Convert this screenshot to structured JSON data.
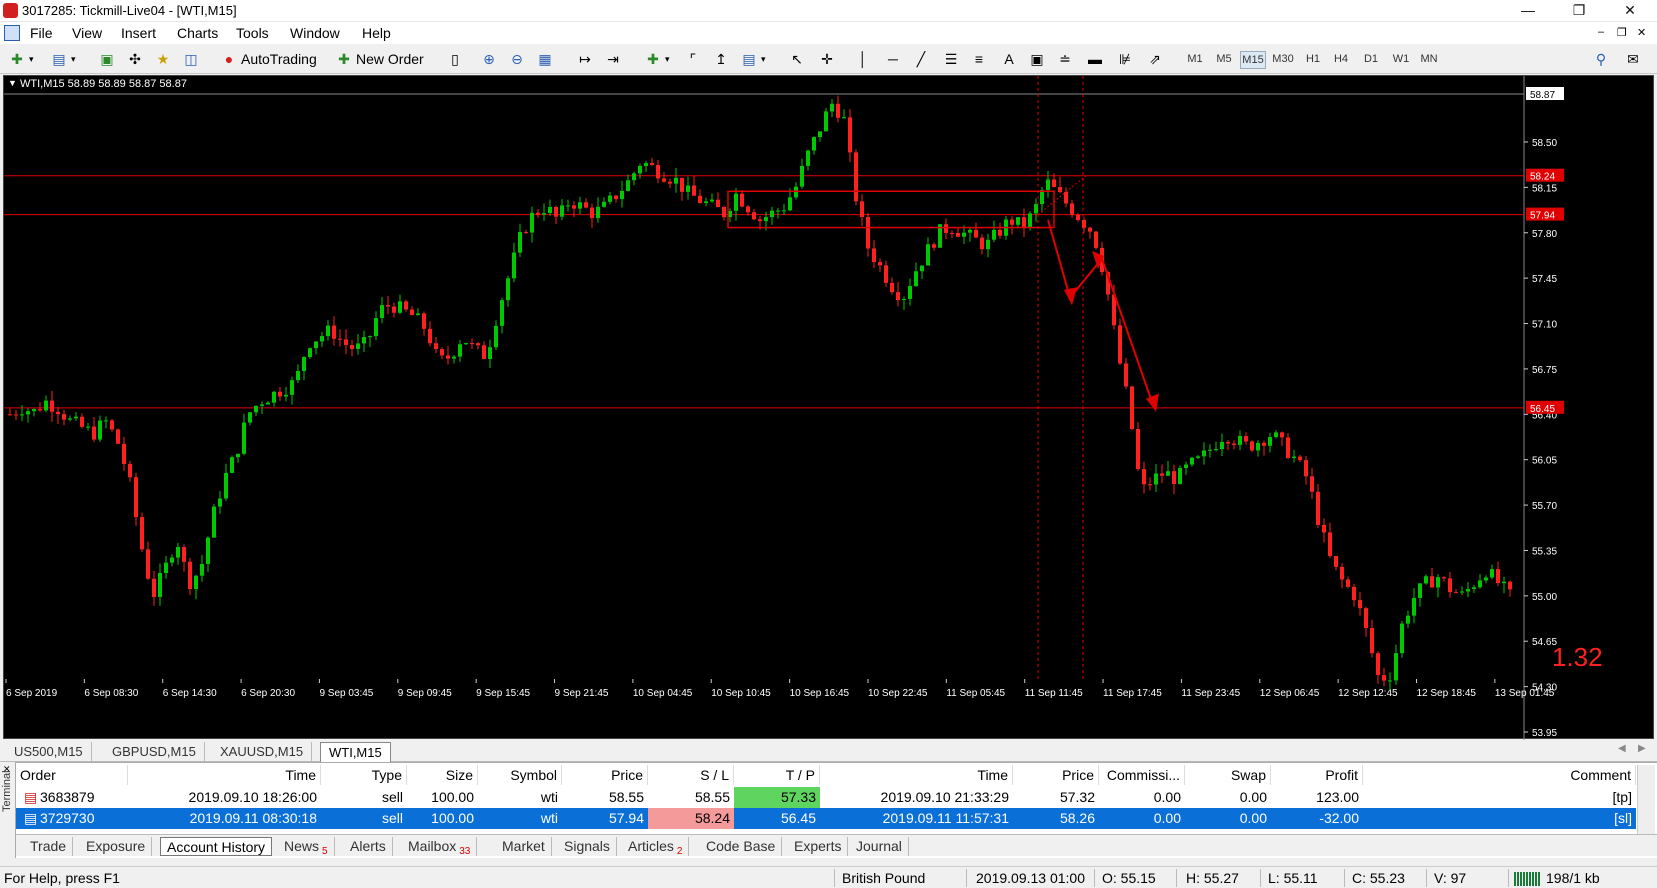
{
  "window": {
    "title": "3017285: Tickmill-Live04 - [WTI,M15]"
  },
  "menu": [
    "File",
    "View",
    "Insert",
    "Charts",
    "Tools",
    "Window",
    "Help"
  ],
  "toolbar": {
    "autotrading": "AutoTrading",
    "new_order": "New Order",
    "timeframes": [
      "M1",
      "M5",
      "M15",
      "M30",
      "H1",
      "H4",
      "D1",
      "W1",
      "MN"
    ],
    "active_timeframe": "M15"
  },
  "chart": {
    "header": "WTI,M15  58.89 58.89 58.87 58.87",
    "current_price": "58.87",
    "price_ticks": [
      "58.50",
      "58.15",
      "57.80",
      "57.45",
      "57.10",
      "56.75",
      "56.40",
      "56.05",
      "55.70",
      "55.35",
      "55.00",
      "54.65",
      "54.30",
      "53.95"
    ],
    "hline_labels": [
      "58.24",
      "57.94",
      "56.45"
    ],
    "time_ticks": [
      "6 Sep 2019",
      "6 Sep 08:30",
      "6 Sep 14:30",
      "6 Sep 20:30",
      "9 Sep 03:45",
      "9 Sep 09:45",
      "9 Sep 15:45",
      "9 Sep 21:45",
      "10 Sep 04:45",
      "10 Sep 10:45",
      "10 Sep 16:45",
      "10 Sep 22:45",
      "11 Sep 05:45",
      "11 Sep 11:45",
      "11 Sep 17:45",
      "11 Sep 23:45",
      "12 Sep 06:45",
      "12 Sep 12:45",
      "12 Sep 18:45",
      "13 Sep 01:45"
    ],
    "spread": "1.32",
    "colors": {
      "bull": "#00c800",
      "bear": "#ff2020",
      "levels": "#e00000",
      "background": "#000000"
    }
  },
  "chart_data": {
    "type": "candlestick",
    "ylim": [
      53.95,
      58.87
    ],
    "close_path": [
      56.4,
      56.45,
      56.42,
      56.5,
      56.45,
      56.35,
      56.3,
      56.25,
      56.35,
      56.2,
      55.9,
      55.4,
      55.0,
      55.2,
      55.45,
      55.1,
      55.2,
      55.6,
      55.9,
      56.1,
      56.4,
      56.5,
      56.55,
      56.6,
      56.65,
      56.95,
      57.0,
      57.05,
      56.95,
      56.9,
      56.95,
      57.2,
      57.25,
      57.2,
      57.15,
      57.05,
      56.8,
      56.85,
      57.0,
      56.9,
      56.85,
      57.2,
      57.5,
      57.8,
      57.95,
      58.0,
      57.9,
      58.05,
      58.0,
      57.95,
      58.0,
      58.1,
      58.2,
      58.35,
      58.3,
      58.25,
      58.2,
      58.1,
      58.05,
      58.0,
      57.95,
      58.1,
      58.0,
      57.9,
      57.95,
      58.0,
      58.15,
      58.4,
      58.6,
      58.8,
      58.7,
      58.1,
      57.7,
      57.55,
      57.4,
      57.3,
      57.5,
      57.65,
      57.8,
      57.85,
      57.8,
      57.75,
      57.7,
      57.8,
      57.9,
      57.85,
      57.95,
      58.2,
      58.1,
      58.0,
      57.9,
      57.8,
      57.45,
      56.9,
      56.45,
      55.8,
      55.9,
      55.95,
      55.9,
      56.0,
      56.05,
      56.15,
      56.25,
      56.2,
      56.15,
      56.2,
      56.25,
      56.15,
      56.05,
      55.9,
      55.55,
      55.25,
      55.1,
      55.0,
      54.7,
      54.35,
      54.4,
      54.8,
      55.0,
      55.1,
      55.15,
      55.05,
      55.0,
      55.1,
      55.2,
      55.1,
      55.0
    ],
    "horizontal_levels": [
      58.24,
      57.94,
      56.45
    ]
  },
  "chart_tabs": [
    {
      "label": "US500,M15",
      "active": false
    },
    {
      "label": "GBPUSD,M15",
      "active": false
    },
    {
      "label": "XAUUSD,M15",
      "active": false
    },
    {
      "label": "WTI,M15",
      "active": true
    }
  ],
  "terminal": {
    "side_label": "Terminal",
    "columns": [
      "Order",
      "Time",
      "Type",
      "Size",
      "Symbol",
      "Price",
      "S / L",
      "T / P",
      "Time",
      "Price",
      "Commissi...",
      "Swap",
      "Profit",
      "Comment"
    ],
    "rows": [
      {
        "order": "3683879",
        "open_time": "2019.09.10 18:26:00",
        "type": "sell",
        "size": "100.00",
        "symbol": "wti",
        "price": "58.55",
        "sl": "58.55",
        "tp": "57.33",
        "close_time": "2019.09.10 21:33:29",
        "close_price": "57.32",
        "commission": "0.00",
        "swap": "0.00",
        "profit": "123.00",
        "comment": "[tp]",
        "selected": false
      },
      {
        "order": "3729730",
        "open_time": "2019.09.11 08:30:18",
        "type": "sell",
        "size": "100.00",
        "symbol": "wti",
        "price": "57.94",
        "sl": "58.24",
        "tp": "56.45",
        "close_time": "2019.09.11 11:57:31",
        "close_price": "58.26",
        "commission": "0.00",
        "swap": "0.00",
        "profit": "-32.00",
        "comment": "[sl]",
        "selected": true
      }
    ],
    "tabs": [
      {
        "label": "Trade"
      },
      {
        "label": "Exposure"
      },
      {
        "label": "Account History",
        "active": true
      },
      {
        "label": "News",
        "badge": "5"
      },
      {
        "label": "Alerts"
      },
      {
        "label": "Mailbox",
        "badge": "33"
      },
      {
        "label": "Market"
      },
      {
        "label": "Signals"
      },
      {
        "label": "Articles",
        "badge": "2"
      },
      {
        "label": "Code Base"
      },
      {
        "label": "Experts"
      },
      {
        "label": "Journal"
      }
    ]
  },
  "status": {
    "help": "For Help, press F1",
    "profile": "British Pound",
    "datetime": "2019.09.13 01:00",
    "open": "O: 55.15",
    "high": "H: 55.27",
    "low": "L: 55.11",
    "close": "C: 55.23",
    "volume": "V: 97",
    "traffic": "198/1 kb"
  }
}
